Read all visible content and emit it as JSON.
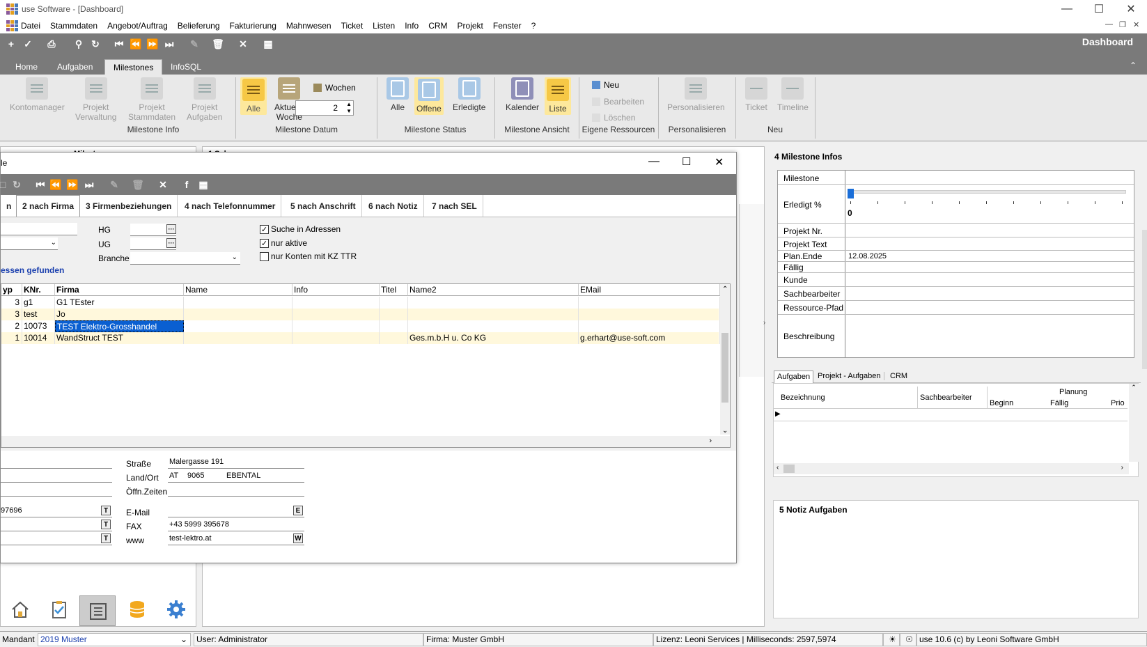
{
  "window": {
    "title": "use Software - [Dashboard]"
  },
  "menu": [
    "Datei",
    "Stammdaten",
    "Angebot/Auftrag",
    "Belieferung",
    "Fakturierung",
    "Mahnwesen",
    "Ticket",
    "Listen",
    "Info",
    "CRM",
    "Projekt",
    "Fenster",
    "?"
  ],
  "dashboard_title": "Dashboard",
  "ribbon_tabs": [
    {
      "label": "Home"
    },
    {
      "label": "Aufgaben"
    },
    {
      "label": "Milestones",
      "active": true
    },
    {
      "label": "InfoSQL"
    }
  ],
  "ribbon": {
    "kontomanager": "Kontomanager",
    "projekt_verwaltung": "Projekt\nVerwaltung",
    "projekt_stammdaten": "Projekt\nStammdaten",
    "projekt_aufgaben": "Projekt\nAufgaben",
    "grp_milestone_info": "Milestone Info",
    "alle": "Alle",
    "aktuelle_woche": "Aktuelle\nWoche",
    "wochen": "Wochen",
    "wochen_value": "2",
    "grp_milestone_datum": "Milestone Datum",
    "status_alle": "Alle",
    "status_offene": "Offene",
    "status_erledigte": "Erledigte",
    "grp_milestone_status": "Milestone Status",
    "kalender": "Kalender",
    "liste": "Liste",
    "grp_milestone_ansicht": "Milestone Ansicht",
    "neu": "Neu",
    "bearbeiten": "Bearbeiten",
    "loeschen": "Löschen",
    "grp_eigene_ressourcen": "Eigene Ressourcen",
    "personalisieren": "Personalisieren",
    "grp_personalisieren": "Personalisieren",
    "ticket": "Ticket",
    "timeline": "Timeline",
    "grp_neu": "Neu"
  },
  "dialog": {
    "title": "le",
    "tabs": [
      "n",
      "2 nach Firma",
      "3 Firmenbeziehungen",
      "4 nach Telefonnummer",
      "5 nach Anschrift",
      "6 nach Notiz",
      "7 nach SEL"
    ],
    "hg": "HG",
    "ug": "UG",
    "branche": "Branche",
    "cb_suche": "Suche in Adressen",
    "cb_nur_aktive": "nur aktive",
    "cb_kz": "nur Konten mit KZ TTR",
    "found": "essen gefunden",
    "columns": [
      "yp",
      "KNr.",
      "Firma",
      "Name",
      "Info",
      "Titel",
      "Name2",
      "EMail"
    ],
    "rows": [
      {
        "typ": "3",
        "knr": "g1",
        "firma": "G1 TEster",
        "name": "",
        "info": "",
        "titel": "",
        "name2": "",
        "email": ""
      },
      {
        "typ": "3",
        "knr": "test",
        "firma": "Jo",
        "name": "",
        "info": "",
        "titel": "",
        "name2": "",
        "email": ""
      },
      {
        "typ": "2",
        "knr": "10073",
        "firma": "TEST Elektro-Grosshandel",
        "name": "",
        "info": "",
        "titel": "",
        "name2": "",
        "email": ""
      },
      {
        "typ": "1",
        "knr": "10014",
        "firma": "WandStruct TEST",
        "name": "",
        "info": "",
        "titel": "",
        "name2": "Ges.m.b.H u. Co KG",
        "email": "g.erhart@use-soft.com"
      }
    ],
    "strasse_lbl": "Straße",
    "strasse": "Malergasse 191",
    "landort_lbl": "Land/Ort",
    "land": "AT",
    "plz": "9065",
    "ort": "EBENTAL",
    "oeffn_lbl": "Öffn.Zeiten",
    "phone": "97696",
    "email_lbl": "E-Mail",
    "fax_lbl": "FAX",
    "fax": "+43 5999 395678",
    "www_lbl": "www",
    "www": "test-lektro.at",
    "btn_t": "T",
    "btn_e": "E",
    "btn_w": "W"
  },
  "milestone_infos": {
    "header": "4 Milestone Infos",
    "milestone": "Milestone",
    "erledigt": "Erledigt %",
    "erledigt_value": "0",
    "erledigt_fraction": 0,
    "projekt_nr": "Projekt Nr.",
    "projekt_text": "Projekt Text",
    "plan_ende": "Plan.Ende",
    "plan_ende_value": "12.08.2025",
    "faellig": "Fällig",
    "kunde": "Kunde",
    "sachbearbeiter": "Sachbearbeiter",
    "ressource_pfad": "Ressource-Pfad",
    "beschreibung": "Beschreibung"
  },
  "lower_tabs": [
    "Aufgaben",
    "Projekt - Aufgaben",
    "CRM"
  ],
  "tasks_grid": {
    "bezeichnung": "Bezeichnung",
    "sachbearbeiter": "Sachbearbeiter",
    "planung": "Planung",
    "beginn": "Beginn",
    "faellig": "Fällig",
    "prio": "Prio"
  },
  "notiz_header": "5 Notiz Aufgaben",
  "bg_labels": {
    "l1": "Milest",
    "l2": "1 Sel"
  },
  "status": {
    "mandant_lbl": "Mandant",
    "mandant": "2019 Muster",
    "user": "User: Administrator",
    "firma": "Firma: Muster GmbH",
    "lizenz": "Lizenz: Leoni Services | Milliseconds: 2597,5974",
    "version": "use 10.6 (c) by Leoni Software GmbH"
  },
  "colors": {
    "toolbar": "#7a7a7a",
    "active_yellow": "#f6c846",
    "selection": "#0a5fd1",
    "alt_row": "#fff8dc"
  }
}
